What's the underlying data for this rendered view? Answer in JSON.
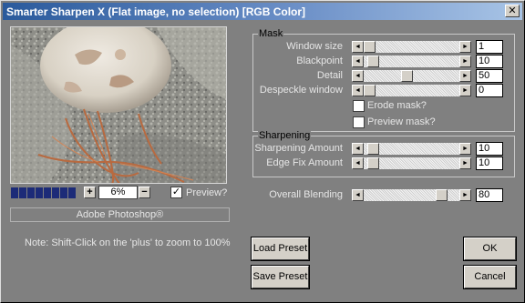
{
  "window": {
    "title": "Smarter Sharpen X (Flat image, no selection) [RGB Color]",
    "close_label": "✕"
  },
  "preview": {
    "progress_segments": 8,
    "zoom_plus": "+",
    "zoom_minus": "−",
    "zoom_value": "6%",
    "preview_checked": true,
    "preview_label": "Preview?"
  },
  "footer": {
    "host_label": "Adobe Photoshop®",
    "note": "Note: Shift-Click on the 'plus' to zoom to 100%"
  },
  "mask": {
    "title": "Mask",
    "sliders": [
      {
        "label": "Window size",
        "value": "1",
        "level": 0.0
      },
      {
        "label": "Blackpoint",
        "value": "10",
        "level": 0.04
      },
      {
        "label": "Detail",
        "value": "50",
        "level": 0.45
      },
      {
        "label": "Despeckle window",
        "value": "0",
        "level": 0.0
      }
    ],
    "erode_label": "Erode mask?",
    "erode_checked": false,
    "preview_mask_label": "Preview mask?",
    "preview_mask_checked": false
  },
  "sharpening": {
    "title": "Sharpening",
    "sliders": [
      {
        "label": "Sharpening Amount",
        "value": "10",
        "level": 0.04
      },
      {
        "label": "Edge Fix Amount",
        "value": "10",
        "level": 0.04
      }
    ]
  },
  "overall": {
    "label": "Overall Blending",
    "value": "80",
    "level": 0.86
  },
  "buttons": {
    "load_preset": "Load Preset",
    "save_preset": "Save Preset",
    "ok": "OK",
    "cancel": "Cancel"
  },
  "icons": {
    "arrow_left": "◄",
    "arrow_right": "►",
    "check": "✓"
  },
  "colors": {
    "dialog_bg": "#808080",
    "title_start": "#2a5a9c",
    "title_end": "#a8c4e6",
    "progress": "#1c2b78"
  }
}
